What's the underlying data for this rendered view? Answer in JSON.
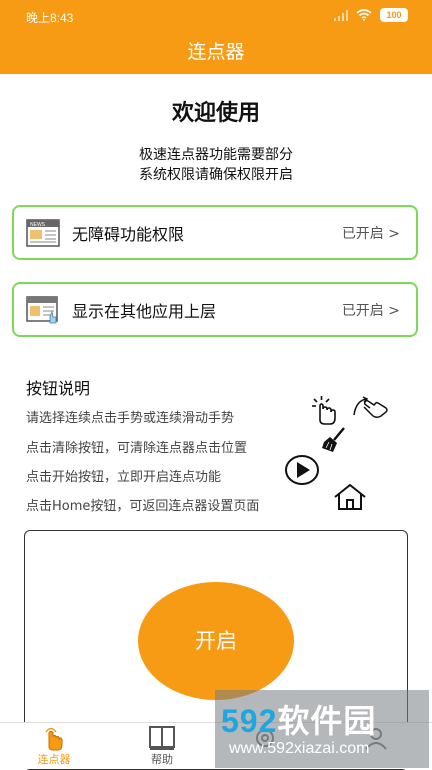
{
  "status_bar": {
    "time": "晚上8:43",
    "battery": "100"
  },
  "app_bar": {
    "title": "连点器"
  },
  "welcome": {
    "title": "欢迎使用",
    "desc_line1": "极速连点器功能需要部分",
    "desc_line2": "系统权限请确保权限开启"
  },
  "permissions": [
    {
      "icon": "news-window-icon",
      "title": "无障碍功能权限",
      "status": "已开启 >"
    },
    {
      "icon": "overlay-window-icon",
      "title": "显示在其他应用上层",
      "status": "已开启 >"
    }
  ],
  "instructions": {
    "title": "按钮说明",
    "lines": [
      "请选择连续点击手势或连续滑动手势",
      "点击清除按钮，可清除连点器点击位置",
      "点击开始按钮，立即开启连点功能",
      "点击Home按钮，可返回连点器设置页面"
    ]
  },
  "start_button": {
    "label": "开启"
  },
  "bottom_nav": [
    {
      "label": "连点器",
      "active": true
    },
    {
      "label": "帮助",
      "active": false
    },
    {
      "label": "",
      "active": false
    },
    {
      "label": "",
      "active": false
    }
  ],
  "watermark": {
    "brand_num": "592",
    "brand_cn": "软件园",
    "url": "www.592xiazai.com"
  },
  "colors": {
    "accent": "#f79a14",
    "border_green": "#7ed957"
  }
}
